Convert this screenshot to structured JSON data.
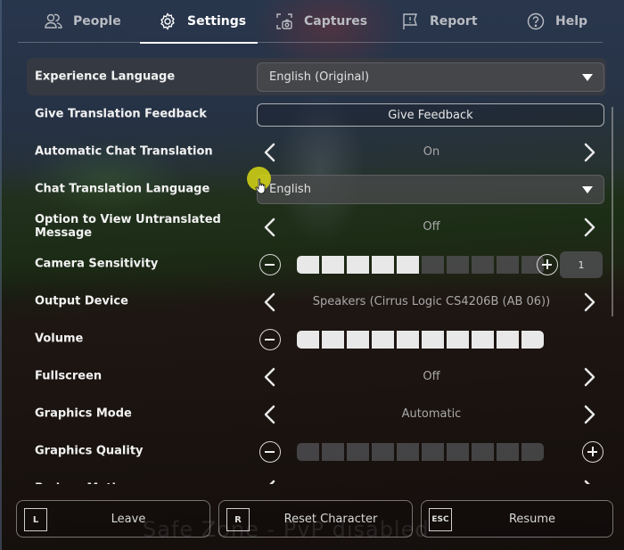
{
  "tabs": [
    {
      "label": "People",
      "icon": "people-icon",
      "active": false
    },
    {
      "label": "Settings",
      "icon": "gear-icon",
      "active": true
    },
    {
      "label": "Captures",
      "icon": "camera-capture-icon",
      "active": false
    },
    {
      "label": "Report",
      "icon": "flag-icon",
      "active": false
    },
    {
      "label": "Help",
      "icon": "question-circle-icon",
      "active": false
    }
  ],
  "settings": {
    "experience_language": {
      "label": "Experience Language",
      "value": "English (Original)"
    },
    "translation_feedback": {
      "label": "Give Translation Feedback",
      "button": "Give Feedback"
    },
    "auto_chat_translation": {
      "label": "Automatic Chat Translation",
      "value": "On"
    },
    "chat_translation_language": {
      "label": "Chat Translation Language",
      "value": "English"
    },
    "view_untranslated": {
      "label": "Option to View Untranslated Message",
      "value": "Off"
    },
    "camera_sensitivity": {
      "label": "Camera Sensitivity",
      "level": 5,
      "max": 10,
      "value": "1"
    },
    "output_device": {
      "label": "Output Device",
      "value": "Speakers (Cirrus Logic CS4206B (AB 06))"
    },
    "volume": {
      "label": "Volume",
      "level": 10,
      "max": 10
    },
    "fullscreen": {
      "label": "Fullscreen",
      "value": "Off"
    },
    "graphics_mode": {
      "label": "Graphics Mode",
      "value": "Automatic"
    },
    "graphics_quality": {
      "label": "Graphics Quality",
      "level": 0,
      "max": 10
    },
    "reduce_motion": {
      "label": "Reduce Motion"
    }
  },
  "bottom_bar": {
    "leave": {
      "key": "L",
      "label": "Leave"
    },
    "reset": {
      "key": "R",
      "label": "Reset Character"
    },
    "resume": {
      "key": "ESC",
      "label": "Resume"
    }
  },
  "background_text": "Safe Zone - PvP disabled"
}
